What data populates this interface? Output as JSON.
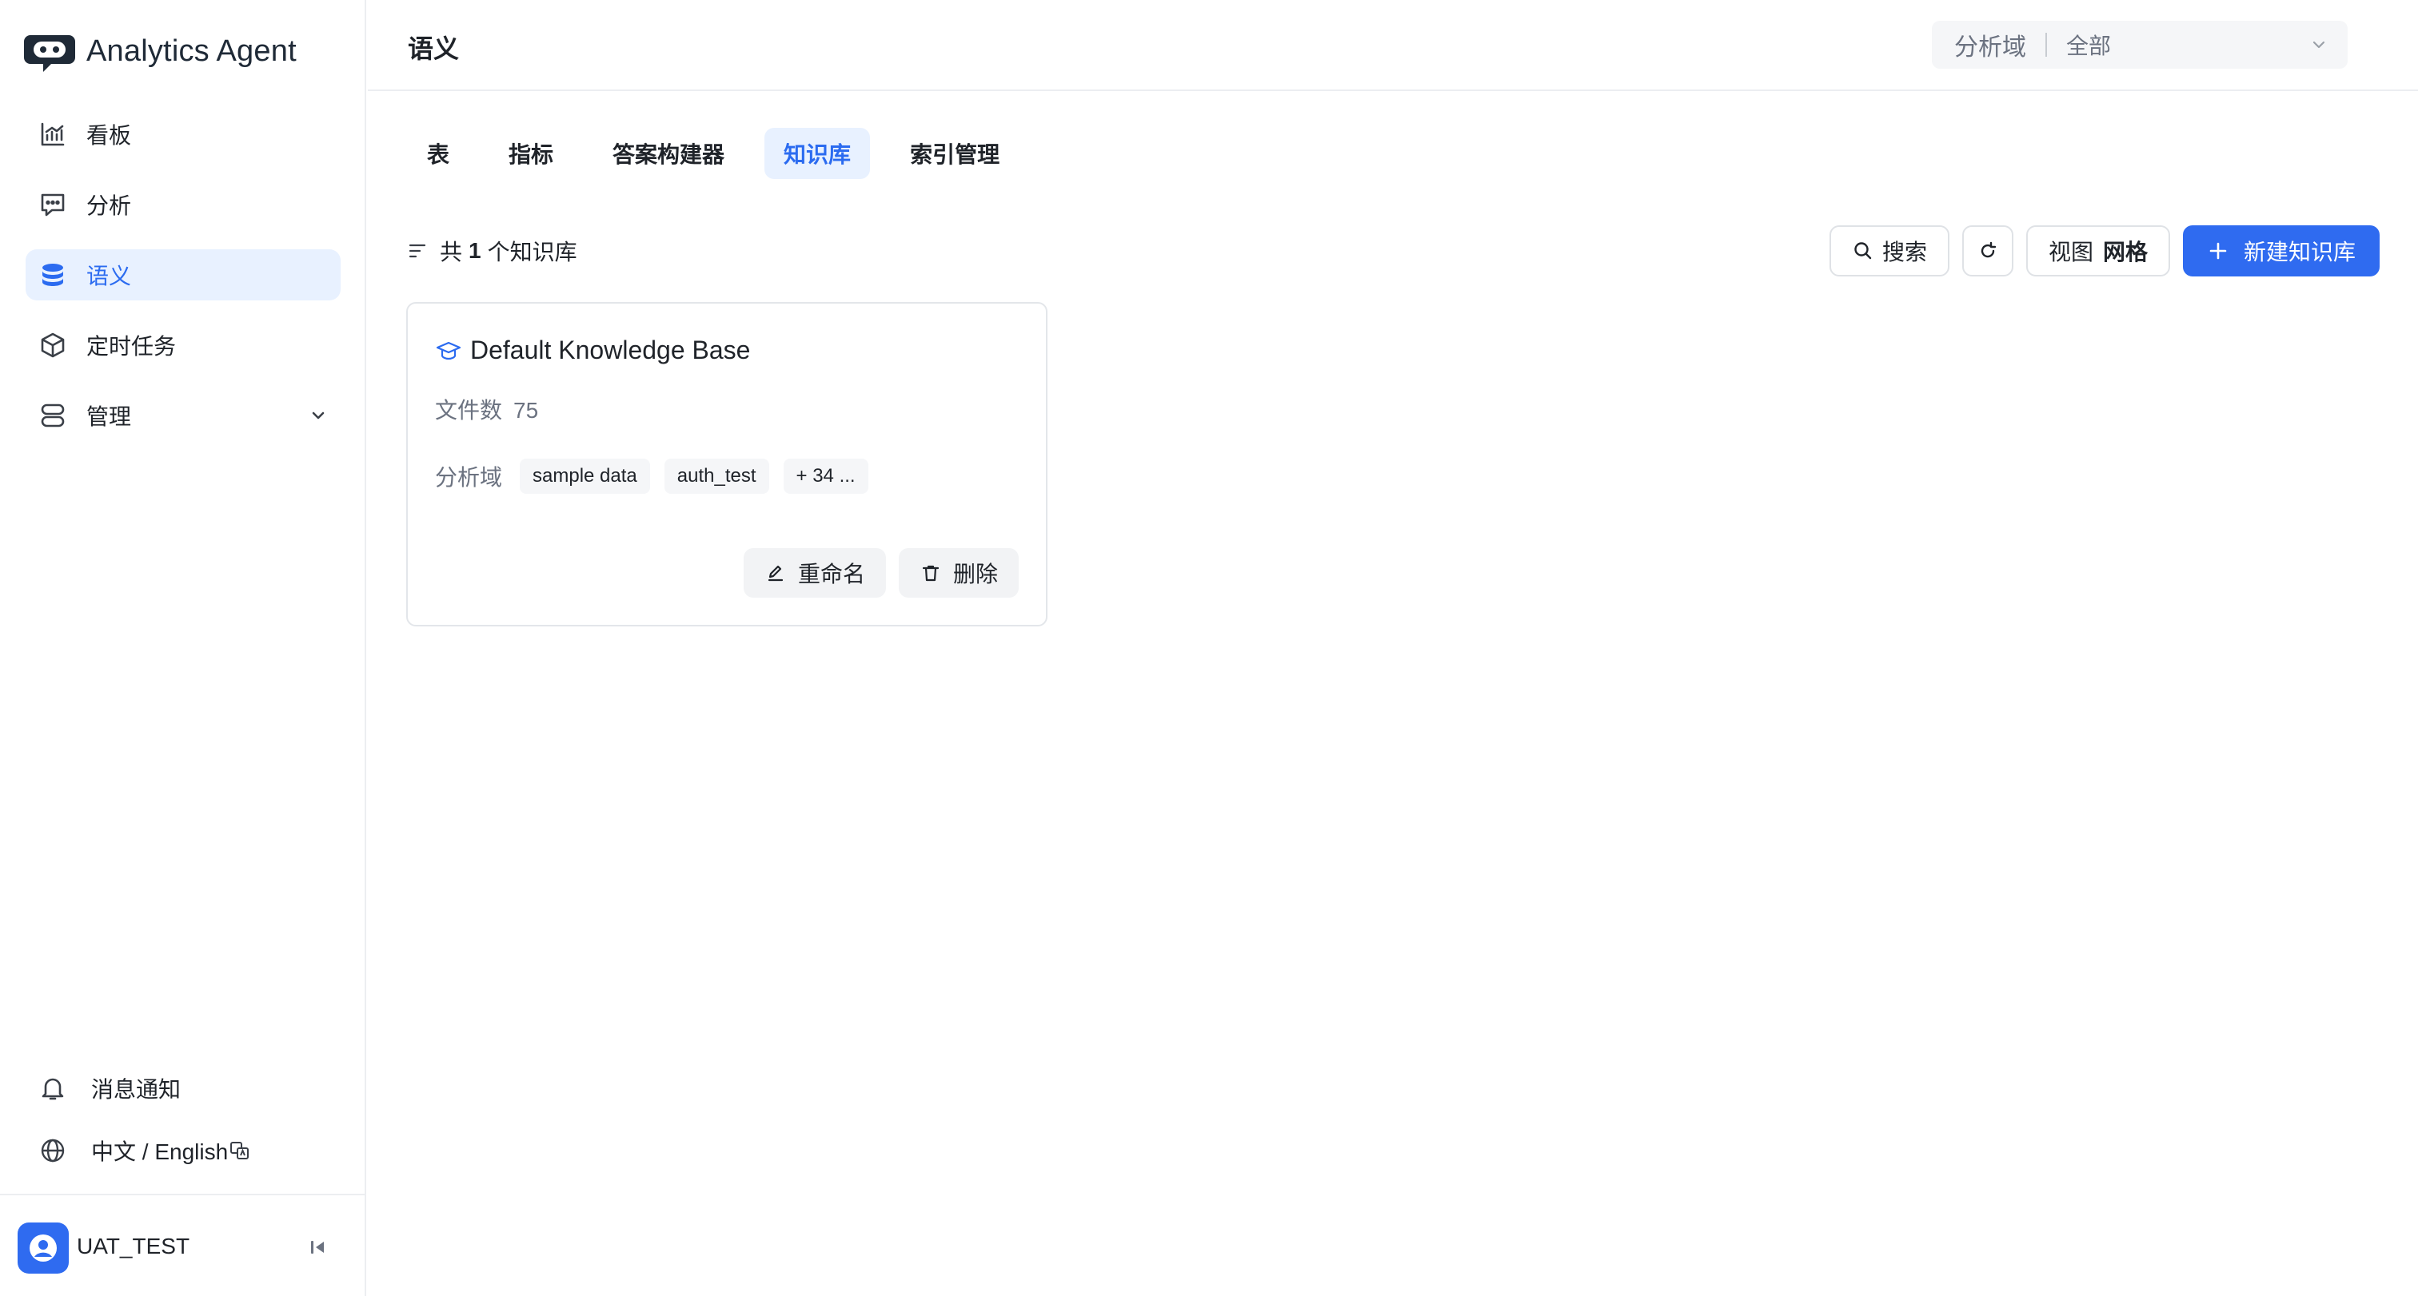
{
  "app": {
    "name": "Analytics Agent",
    "logo_icon": "robot-chat-logo"
  },
  "sidebar": {
    "items": [
      {
        "label": "看板",
        "icon": "chart-board-icon",
        "active": false
      },
      {
        "label": "分析",
        "icon": "chat-icon",
        "active": false
      },
      {
        "label": "语义",
        "icon": "database-icon",
        "active": true
      },
      {
        "label": "定时任务",
        "icon": "cube-icon",
        "active": false
      },
      {
        "label": "管理",
        "icon": "server-icon",
        "active": false,
        "expandable": true
      }
    ],
    "bottom": [
      {
        "label": "消息通知",
        "icon": "bell-icon"
      },
      {
        "label": "中文 / English",
        "icon": "globe-icon"
      }
    ],
    "user": {
      "name": "UAT_TEST"
    }
  },
  "header": {
    "title": "语义",
    "domain_label": "分析域",
    "domain_value": "全部"
  },
  "tabs": [
    {
      "label": "表",
      "active": false
    },
    {
      "label": "指标",
      "active": false
    },
    {
      "label": "答案构建器",
      "active": false
    },
    {
      "label": "知识库",
      "active": true
    },
    {
      "label": "索引管理",
      "active": false
    }
  ],
  "toolbar": {
    "summary_prefix": "共",
    "summary_count": "1",
    "summary_suffix": "个知识库",
    "search_label": "搜索",
    "view_label": "视图",
    "view_value": "网格",
    "new_label": "新建知识库"
  },
  "cards": [
    {
      "title": "Default Knowledge Base",
      "file_count_label": "文件数",
      "file_count": "75",
      "domain_label": "分析域",
      "domains": [
        "sample data",
        "auth_test"
      ],
      "more": "+ 34 ...",
      "rename_label": "重命名",
      "delete_label": "删除"
    }
  ],
  "colors": {
    "accent": "#2f6bf0",
    "active_bg": "#e8f1ff",
    "border": "#e3e6ea"
  }
}
